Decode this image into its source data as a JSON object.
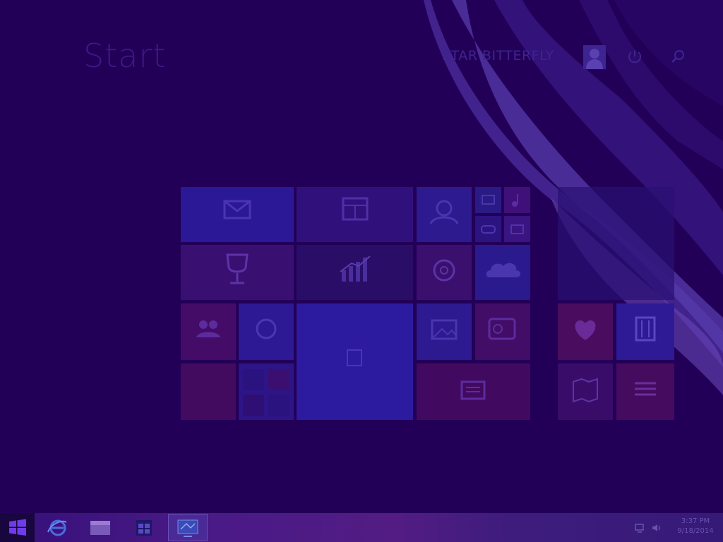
{
  "start": {
    "title": "Start"
  },
  "user": {
    "name": "STAR BITTERFLY"
  },
  "taskbar": {
    "buttons": [
      {
        "name": "internet-explorer"
      },
      {
        "name": "file-explorer"
      },
      {
        "name": "store"
      },
      {
        "name": "remote-desktop"
      }
    ]
  },
  "tray": {
    "time": "3:37 PM",
    "date": "9/18/2014"
  },
  "colors": {
    "background": "#230058",
    "taskbar_start": "#17073e",
    "tile_blue": "#2a1a9a",
    "tile_red": "#4a0c5c",
    "tile_green": "#2a0c66"
  }
}
